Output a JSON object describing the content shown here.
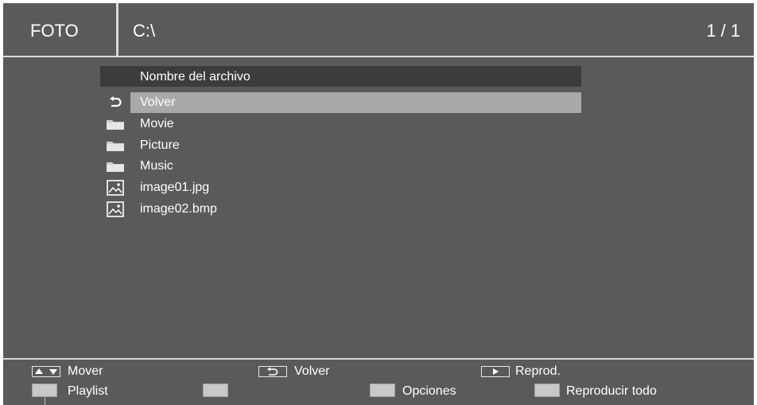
{
  "header": {
    "mode": "FOTO",
    "path": "C:\\",
    "page": "1 / 1"
  },
  "list": {
    "column_header": "Nombre del archivo",
    "items": [
      {
        "label": "Volver",
        "icon": "back-icon",
        "selected": true
      },
      {
        "label": "Movie",
        "icon": "folder-icon"
      },
      {
        "label": "Picture",
        "icon": "folder-icon"
      },
      {
        "label": "Music",
        "icon": "folder-icon"
      },
      {
        "label": "image01.jpg",
        "icon": "image-file-icon"
      },
      {
        "label": "image02.bmp",
        "icon": "image-file-icon"
      }
    ]
  },
  "footer": {
    "row1": [
      {
        "key": "up-down-arrows-icon",
        "label": "Mover"
      },
      {
        "key": "back-key-icon",
        "label": "Volver"
      },
      {
        "key": "play-key-icon",
        "label": "Reprod."
      }
    ],
    "row2": [
      {
        "key": "color-key-1",
        "label": "Playlist"
      },
      {
        "key": "color-key-2",
        "label": ""
      },
      {
        "key": "color-key-3",
        "label": "Opciones"
      },
      {
        "key": "color-key-4",
        "label": "Reproducir todo"
      }
    ]
  },
  "colors": {
    "background": "#5a5a5a",
    "column_header": "#3c3c3c",
    "selection": "#a9a9a9",
    "divider": "#d9d9d9"
  }
}
